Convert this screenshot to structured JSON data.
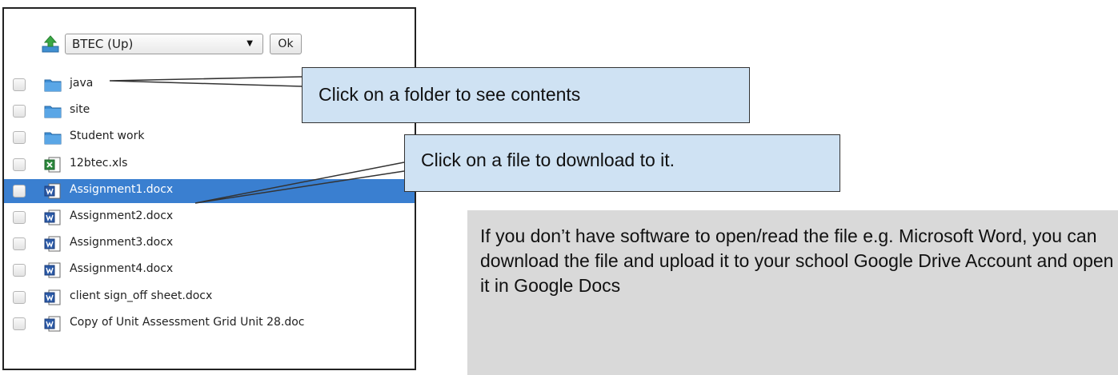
{
  "toolbar": {
    "up_icon": "folder-up-icon",
    "folder_select_value": "BTEC (Up)",
    "ok_label": "Ok"
  },
  "files": [
    {
      "name": "java",
      "icon": "folder-icon",
      "selected": false
    },
    {
      "name": "site",
      "icon": "folder-icon",
      "selected": false
    },
    {
      "name": "Student work",
      "icon": "folder-icon",
      "selected": false
    },
    {
      "name": "12btec.xls",
      "icon": "excel-file-icon",
      "selected": false
    },
    {
      "name": "Assignment1.docx",
      "icon": "word-file-icon",
      "selected": true
    },
    {
      "name": "Assignment2.docx",
      "icon": "word-file-icon",
      "selected": false
    },
    {
      "name": "Assignment3.docx",
      "icon": "word-file-icon",
      "selected": false
    },
    {
      "name": "Assignment4.docx",
      "icon": "word-file-icon",
      "selected": false
    },
    {
      "name": "client sign_off sheet.docx",
      "icon": "word-file-icon",
      "selected": false
    },
    {
      "name": "Copy of Unit Assessment Grid Unit 28.doc",
      "icon": "word-file-icon",
      "selected": false
    }
  ],
  "callouts": {
    "folder_tip": "Click on a folder to see contents",
    "file_tip": "Click on a file to download to it."
  },
  "note": "If you don’t have software to open/read the file e.g. Microsoft Word, you can download the file and upload it to your school Google Drive Account and open it in Google Docs",
  "colors": {
    "selection": "#3a7fd0",
    "callout_fill": "#cfe2f3",
    "note_fill": "#d9d9d9"
  }
}
